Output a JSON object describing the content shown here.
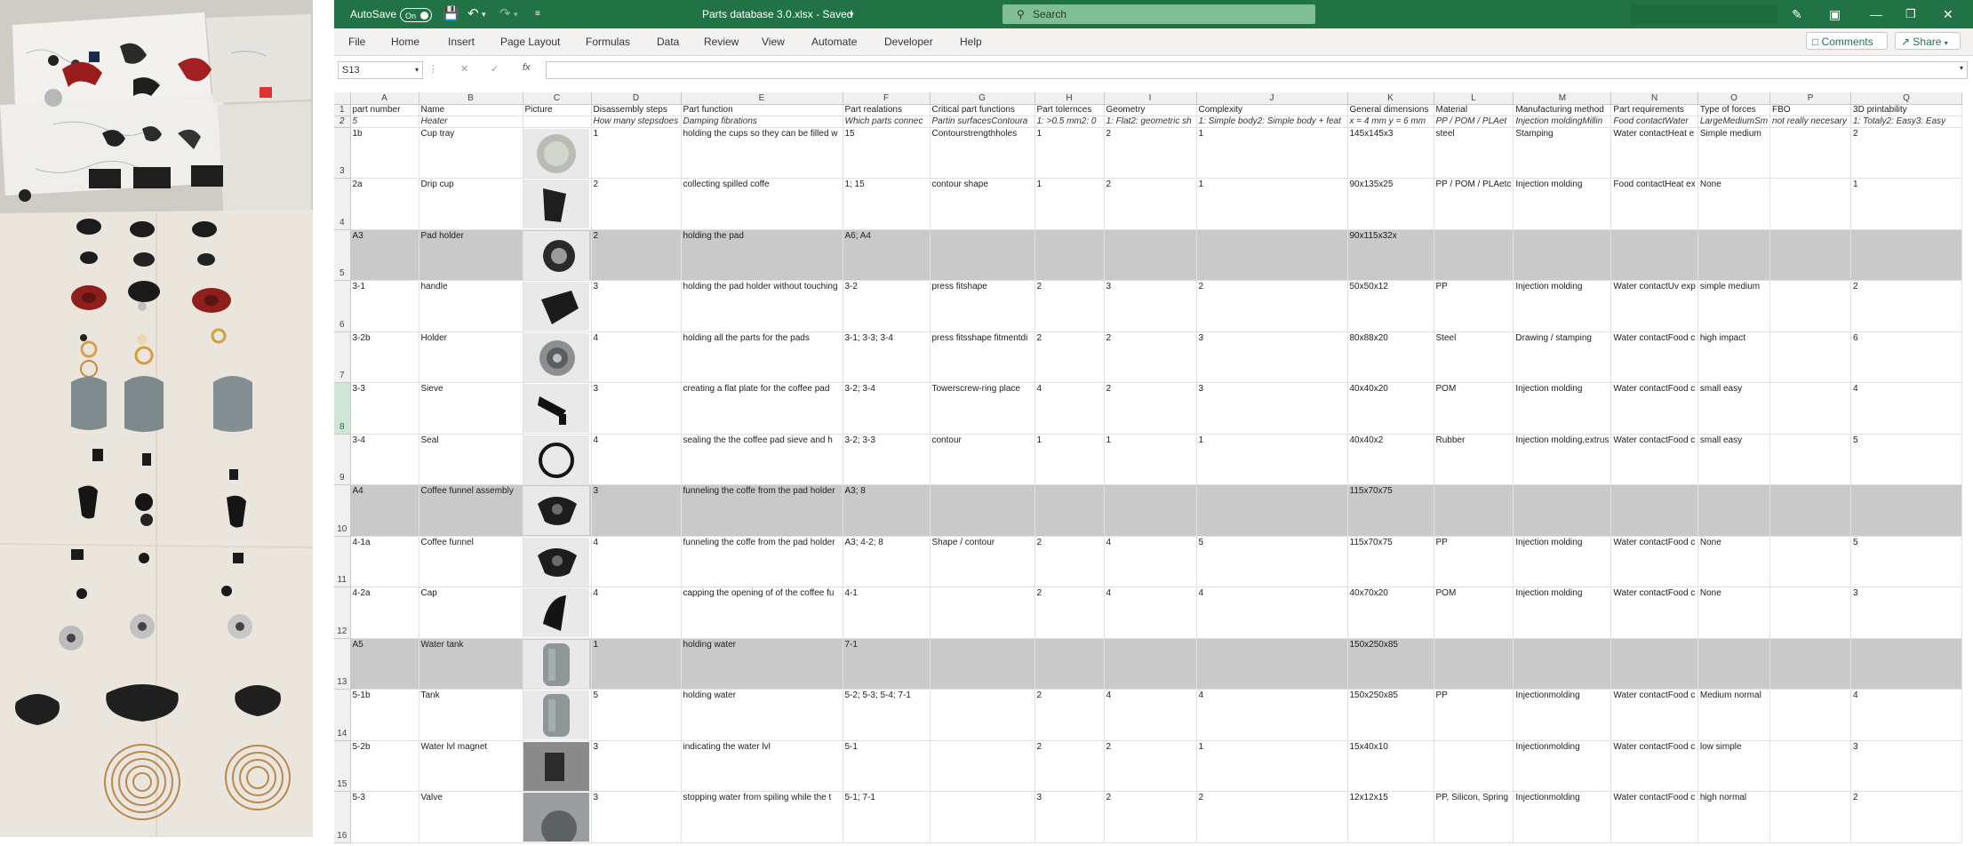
{
  "titlebar": {
    "autosave_label": "AutoSave",
    "autosave_state": "On",
    "file_title": "Parts database 3.0.xlsx - Saved",
    "search_placeholder": "Search"
  },
  "menubar": {
    "items": [
      "File",
      "Home",
      "Insert",
      "Page Layout",
      "Formulas",
      "Data",
      "Review",
      "View",
      "Automate",
      "Developer",
      "Help"
    ],
    "comments_label": "Comments",
    "share_label": "Share"
  },
  "formula_bar": {
    "name_box": "S13",
    "fx_label": "fx",
    "value": ""
  },
  "colors": {
    "excel_green": "#217346",
    "grey_row": "#c9c9c9",
    "selected_row_header": "#cfe6d6"
  },
  "sheet": {
    "columns": [
      "A",
      "B",
      "C",
      "D",
      "E",
      "F",
      "G",
      "H",
      "I",
      "J",
      "K",
      "L",
      "M",
      "N",
      "O",
      "P",
      "Q"
    ],
    "header_row": [
      "part number",
      "Name",
      "Picture",
      "Disassembly steps",
      "Part function",
      "Part realations",
      "Critical part functions",
      "Part tolernces",
      "Geometry",
      "Complexity",
      "General dimensions",
      "Material",
      "Manufacturing method",
      "Part requirements",
      "Type of forces",
      "FBO",
      "3D printability"
    ],
    "description_row": [
      "5",
      "Heater",
      "",
      "How many stepsdoes",
      "Damping fibrations",
      "Which parts connec",
      "Partin surfacesContoura",
      "1: >0.5 mm2: 0",
      "1: Flat2: geometric sh",
      "1: Simple body2: Simple body + feat",
      "x = 4 mm y = 6 mm",
      "PP / POM / PLAet",
      "Injection moldingMillin",
      "Food contactWater",
      "LargeMediumSm",
      "not really necesary",
      "1: Totaly2: Easy3: Easy"
    ],
    "rows": [
      {
        "num": "3",
        "grey": false,
        "cells": [
          "1b",
          "Cup tray",
          "",
          "1",
          "holding the cups so they can be filled w",
          "15",
          "Contourstrengthholes",
          "1",
          "2",
          "1",
          "145x145x3",
          "steel",
          "Stamping",
          "Water contactHeat e",
          "Simple medium",
          "",
          "2"
        ]
      },
      {
        "num": "4",
        "grey": false,
        "cells": [
          "2a",
          "Drip cup",
          "",
          "2",
          "collecting spilled coffe",
          "1; 15",
          "contour shape",
          "1",
          "2",
          "1",
          "90x135x25",
          "PP / POM / PLAetc",
          "Injection molding",
          "Food contactHeat ex",
          "None",
          "",
          "1"
        ]
      },
      {
        "num": "5",
        "grey": true,
        "cells": [
          "A3",
          "Pad holder",
          "",
          "2",
          "holding the pad",
          "A6; A4",
          "",
          "",
          "",
          "",
          "90x115x32x",
          "",
          "",
          "",
          "",
          "",
          ""
        ]
      },
      {
        "num": "6",
        "grey": false,
        "cells": [
          "3-1",
          "handle",
          "",
          "3",
          "holding the pad holder without touching",
          "3-2",
          "press fitshape",
          "2",
          "3",
          "2",
          "50x50x12",
          "PP",
          "Injection molding",
          "Water contactUv exp",
          "simple medium",
          "",
          "2"
        ]
      },
      {
        "num": "7",
        "grey": false,
        "cells": [
          "3-2b",
          "Holder",
          "",
          "4",
          "holding all the parts for the pads",
          "3-1; 3-3; 3-4",
          "press fitsshape fitmentdi",
          "2",
          "2",
          "3",
          "80x88x20",
          "Steel",
          "Drawing / stamping",
          "Water contactFood c",
          "high impact",
          "",
          "6"
        ]
      },
      {
        "num": "8",
        "grey": false,
        "cells": [
          "3-3",
          "Sieve",
          "",
          "3",
          "creating a flat plate for the coffee pad",
          "3-2; 3-4",
          "Towerscrew-ring place",
          "4",
          "2",
          "3",
          "40x40x20",
          "POM",
          "Injection molding",
          "Water contactFood c",
          "small easy",
          "",
          "4"
        ]
      },
      {
        "num": "9",
        "grey": false,
        "cells": [
          "3-4",
          "Seal",
          "",
          "4",
          "sealing the the coffee pad sieve and h",
          "3-2; 3-3",
          "contour",
          "1",
          "1",
          "1",
          "40x40x2",
          "Rubber",
          "Injection molding,extrus",
          "Water contactFood c",
          "small easy",
          "",
          "5"
        ]
      },
      {
        "num": "10",
        "grey": true,
        "cells": [
          "A4",
          "Coffee funnel assembly",
          "",
          "3",
          "funneling the coffe from the pad holder",
          "A3; 8",
          "",
          "",
          "",
          "",
          "115x70x75",
          "",
          "",
          "",
          "",
          "",
          ""
        ]
      },
      {
        "num": "11",
        "grey": false,
        "cells": [
          "4-1a",
          "Coffee funnel",
          "",
          "4",
          "funneling the coffe from the pad holder",
          "A3; 4-2; 8",
          "Shape / contour",
          "2",
          "4",
          "5",
          "115x70x75",
          "PP",
          "Injection molding",
          "Water contactFood c",
          "None",
          "",
          "5"
        ]
      },
      {
        "num": "12",
        "grey": false,
        "cells": [
          "4-2a",
          "Cap",
          "",
          "4",
          "capping the opening of of the coffee fu",
          "4-1",
          "",
          "2",
          "4",
          "4",
          "40x70x20",
          "POM",
          "Injection molding",
          "Water contactFood c",
          "None",
          "",
          "3"
        ]
      },
      {
        "num": "13",
        "grey": true,
        "cells": [
          "A5",
          "Water tank",
          "",
          "1",
          "holding water",
          "7-1",
          "",
          "",
          "",
          "",
          "150x250x85",
          "",
          "",
          "",
          "",
          "",
          ""
        ]
      },
      {
        "num": "14",
        "grey": false,
        "cells": [
          "5-1b",
          "Tank",
          "",
          "5",
          "holding water",
          "5-2; 5-3; 5-4; 7-1",
          "",
          "2",
          "4",
          "4",
          "150x250x85",
          "PP",
          "Injectionmolding",
          "Water contactFood c",
          "Medium normal",
          "",
          "4"
        ]
      },
      {
        "num": "15",
        "grey": false,
        "cells": [
          "5-2b",
          "Water lvl magnet",
          "",
          "3",
          "indicating the water lvl",
          "5-1",
          "",
          "2",
          "2",
          "1",
          "15x40x10",
          "",
          "Injectionmolding",
          "Water contactFood c",
          "low simple",
          "",
          "3"
        ]
      },
      {
        "num": "16",
        "grey": false,
        "cells": [
          "5-3",
          "Valve",
          "",
          "3",
          "stopping water from spiling while the t",
          "5-1; 7-1",
          "",
          "3",
          "2",
          "2",
          "12x12x15",
          "PP, Silicon, Spring",
          "Injectionmolding",
          "Water contactFood c",
          "high normal",
          "",
          "2"
        ]
      }
    ]
  }
}
